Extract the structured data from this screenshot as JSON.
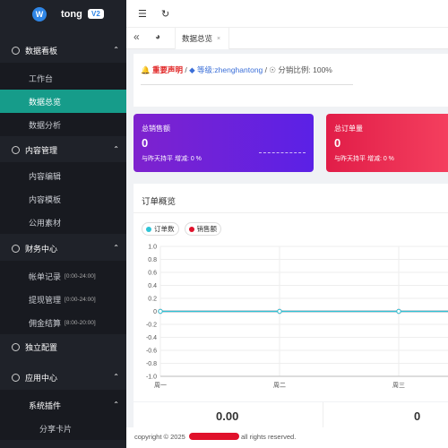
{
  "brand": {
    "logo": "W",
    "name": "tong",
    "version": "V2"
  },
  "sidebar": {
    "groups": [
      {
        "label": "数据看板",
        "icon": "dashboard-icon",
        "items": [
          "工作台",
          "数据总览",
          "数据分析"
        ]
      },
      {
        "label": "内容管理",
        "icon": "gear-icon",
        "items": [
          "内容编辑",
          "内容模板",
          "公用素材"
        ]
      },
      {
        "label": "财务中心",
        "icon": "yen-icon",
        "items": [
          {
            "label": "帐单记录",
            "range": "[0:00-24:00]"
          },
          {
            "label": "提现管理",
            "range": "[0:00-24:00]"
          },
          {
            "label": "佣金结算",
            "range": "[8:00-20:00]"
          }
        ]
      },
      {
        "label": "独立配置",
        "icon": "settings-icon"
      },
      {
        "label": "应用中心",
        "icon": "cube-icon",
        "items": [
          "系统插件",
          "分享卡片"
        ]
      }
    ]
  },
  "tabs": {
    "active": "数据总览",
    "close": "×"
  },
  "notice": {
    "label": "重要声明",
    "sep1": "/",
    "level": "等级:zhenghantong",
    "sep2": "/",
    "ratio": "分销比例: 100%"
  },
  "cards": [
    {
      "title": "总销售额",
      "value": "0",
      "compare": "与昨天持平 增减: 0 %"
    },
    {
      "title": "总订单量",
      "value": "0",
      "compare": "与昨天持平 增减: 0 %"
    }
  ],
  "order_panel": {
    "title": "订单概览",
    "legend": [
      {
        "name": "订单数",
        "color": "#2ec4d6"
      },
      {
        "name": "销售额",
        "color": "#e0112b"
      }
    ]
  },
  "chart_data": {
    "type": "line",
    "categories": [
      "周一",
      "周二",
      "周三"
    ],
    "series": [
      {
        "name": "订单数",
        "values": [
          0,
          0,
          0,
          0
        ]
      },
      {
        "name": "销售额",
        "values": [
          0,
          0,
          0,
          0
        ]
      }
    ],
    "ylim": [
      -1.0,
      1.0
    ],
    "yticks": [
      "1.0",
      "0.8",
      "0.6",
      "0.4",
      "0.2",
      "0",
      "-0.2",
      "-0.4",
      "-0.6",
      "-0.8",
      "-1.0"
    ],
    "grid": true,
    "legend_position": "top-left"
  },
  "stats": {
    "left": "0.00",
    "right": "0"
  },
  "footer": {
    "prefix": "copyright © 2025",
    "suffix": "all rights reserved."
  }
}
